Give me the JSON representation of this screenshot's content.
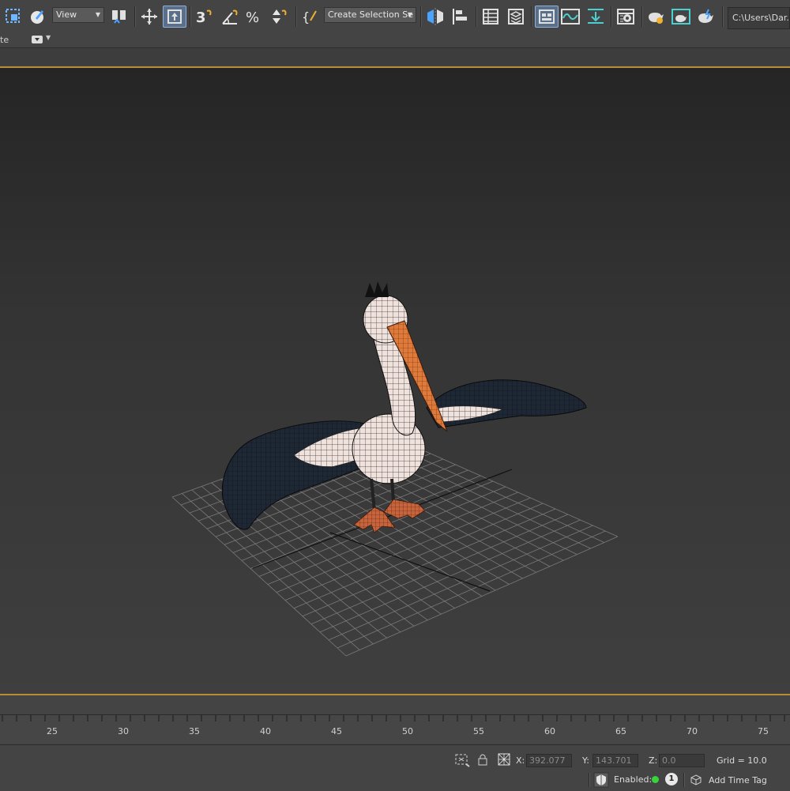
{
  "toolbar": {
    "view_dropdown": "View",
    "selection_set_dropdown": "Create Selection Se",
    "path": "C:\\Users\\Dar..."
  },
  "subbar": {
    "label": "te"
  },
  "timeline": {
    "ticks": [
      "25",
      "30",
      "35",
      "40",
      "45",
      "50",
      "55",
      "60",
      "65",
      "70",
      "75"
    ]
  },
  "status": {
    "x_label": "X:",
    "x_value": "392.077",
    "y_label": "Y:",
    "y_value": "143.701",
    "z_label": "Z:",
    "z_value": "0.0",
    "grid": "Grid = 10.0",
    "enabled_label": "Enabled:",
    "badge": "1",
    "add_time_tag": "Add Time Tag"
  },
  "colors": {
    "viewport_border": "#b78e35",
    "active_tool": "#5a6f8a",
    "beak": "#e07a3a",
    "enabled_dot": "#37d43a"
  },
  "icons": [
    "select-region-icon",
    "paint-select-icon",
    "select-and-link-icon",
    "move-icon",
    "select-object-icon",
    "snap-3d-icon",
    "angle-snap-icon",
    "percent-snap-icon",
    "spinner-snap-icon",
    "named-selection-icon",
    "mirror-icon",
    "align-icon",
    "scene-explorer-icon",
    "layer-explorer-icon",
    "ribbon-icon",
    "curve-editor-icon",
    "schematic-view-icon",
    "material-editor-icon",
    "render-setup-icon",
    "rendered-frame-icon",
    "render-icon",
    "render-cloud-icon"
  ]
}
